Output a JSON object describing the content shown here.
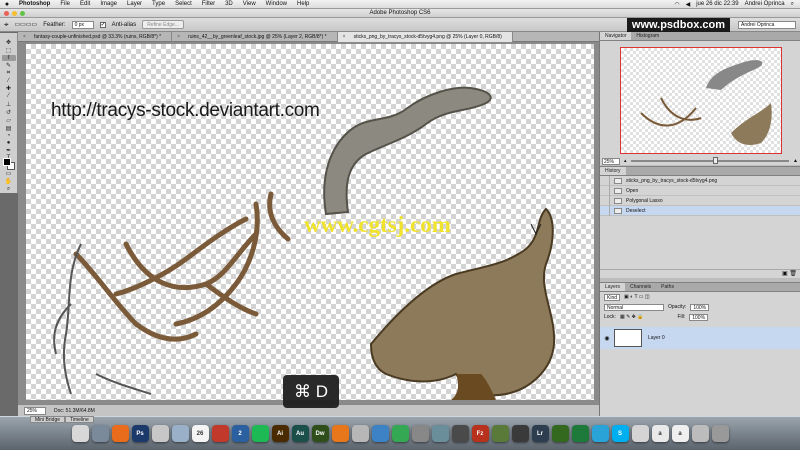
{
  "menubar": {
    "app": "Photoshop",
    "items": [
      "File",
      "Edit",
      "Image",
      "Layer",
      "Type",
      "Select",
      "Filter",
      "3D",
      "View",
      "Window",
      "Help"
    ],
    "clock": "jue 26 dic  22:39",
    "user": "Andrei Oprinca"
  },
  "window": {
    "title": "Adobe Photoshop CS6"
  },
  "options": {
    "feather_label": "Feather:",
    "feather_value": "0 px",
    "antialias_label": "Anti-alias",
    "refine_button": "Refine Edge...",
    "workspace": "Andrei Oprinca"
  },
  "brand": "www.psdbox.com",
  "doc_tabs": [
    "fantasy-couple-unfinished.psd @ 33.3% (ruins, RGB/8*) *",
    "ruins_42__by_greenleaf_stock.jpg @ 25% (Layer 2, RGB/8*) *",
    "sticks_png_by_tracys_stock-d5tvyg4.png @ 25% (Layer 0, RGB/8)"
  ],
  "canvas": {
    "url_text": "http://tracys-stock.deviantart.com",
    "watermark": "www.cgtsj.com"
  },
  "status": {
    "zoom": "25%",
    "doc": "Doc: 51.3M/64.8M"
  },
  "key_overlay": "⌘ D",
  "navigator": {
    "tabs": [
      "Navigator",
      "Histogram"
    ],
    "zoom": "25%",
    "zoom_fraction": 0.52
  },
  "history": {
    "title": "History",
    "snapshot": "sticks_png_by_tracys_stock-d5tvyg4.png",
    "steps": [
      "Open",
      "Polygonal Lasso",
      "Deselect"
    ],
    "selected_index": 2
  },
  "layers": {
    "tabs": [
      "Layers",
      "Channels",
      "Paths"
    ],
    "kind": "Kind",
    "blend_mode": "Normal",
    "opacity_label": "Opacity:",
    "opacity": "100%",
    "lock_label": "Lock:",
    "fill_label": "Fill:",
    "fill": "100%",
    "layer_name": "Layer 0"
  },
  "bottom_tabs": [
    "Mini Bridge",
    "Timeline"
  ],
  "dock": [
    {
      "label": "",
      "color": "#d8d8d8"
    },
    {
      "label": "",
      "color": "#7a8a9a"
    },
    {
      "label": "",
      "color": "#e86c1c"
    },
    {
      "label": "Ps",
      "color": "#1b3a6b"
    },
    {
      "label": "",
      "color": "#c7c7c7"
    },
    {
      "label": "",
      "color": "#9ab0c8"
    },
    {
      "label": "26",
      "color": "#f4f4f4"
    },
    {
      "label": "",
      "color": "#c0392b"
    },
    {
      "label": "2",
      "color": "#2a5fa0"
    },
    {
      "label": "",
      "color": "#1db954"
    },
    {
      "label": "Ai",
      "color": "#4a2a00"
    },
    {
      "label": "Au",
      "color": "#1b4f4a"
    },
    {
      "label": "Dw",
      "color": "#2f4f1a"
    },
    {
      "label": "",
      "color": "#e8761a"
    },
    {
      "label": "",
      "color": "#b7b7b7"
    },
    {
      "label": "",
      "color": "#3d82c4"
    },
    {
      "label": "",
      "color": "#35a853"
    },
    {
      "label": "",
      "color": "#888888"
    },
    {
      "label": "",
      "color": "#6b8e9b"
    },
    {
      "label": "",
      "color": "#4a4a4a"
    },
    {
      "label": "Fz",
      "color": "#b7311d"
    },
    {
      "label": "",
      "color": "#5a7a3a"
    },
    {
      "label": "",
      "color": "#3a3a3a"
    },
    {
      "label": "Lr",
      "color": "#2c3e50"
    },
    {
      "label": "",
      "color": "#33691e"
    },
    {
      "label": "",
      "color": "#1e7a3a"
    },
    {
      "label": "",
      "color": "#29a3d8"
    },
    {
      "label": "S",
      "color": "#00aff0"
    },
    {
      "label": "",
      "color": "#d4d4d4"
    },
    {
      "label": "a",
      "color": "#e9e9e9"
    },
    {
      "label": "a",
      "color": "#efefef"
    },
    {
      "label": "",
      "color": "#bcbcbc"
    },
    {
      "label": "",
      "color": "#999999"
    }
  ]
}
